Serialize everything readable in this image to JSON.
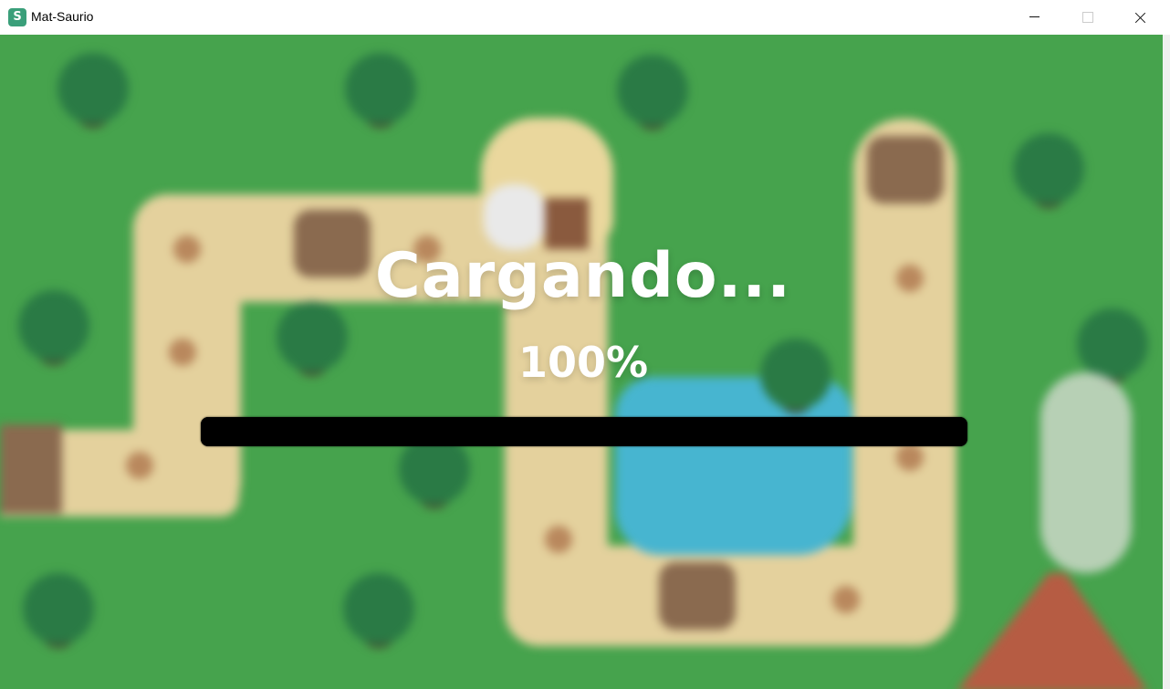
{
  "window": {
    "title": "Mat-Saurio",
    "icon": "S"
  },
  "loading": {
    "title": "Cargando...",
    "percent_text": "100%",
    "progress_value": 1.0
  },
  "colors": {
    "grass": "#46a34d",
    "path": "#e4d19d",
    "water": "#47b5d0",
    "text": "#ffffff",
    "bar": "#000000"
  },
  "icons": {
    "app": "mat-saurio-app-icon",
    "minimize": "minimize-icon",
    "maximize": "maximize-icon",
    "close": "close-icon"
  }
}
